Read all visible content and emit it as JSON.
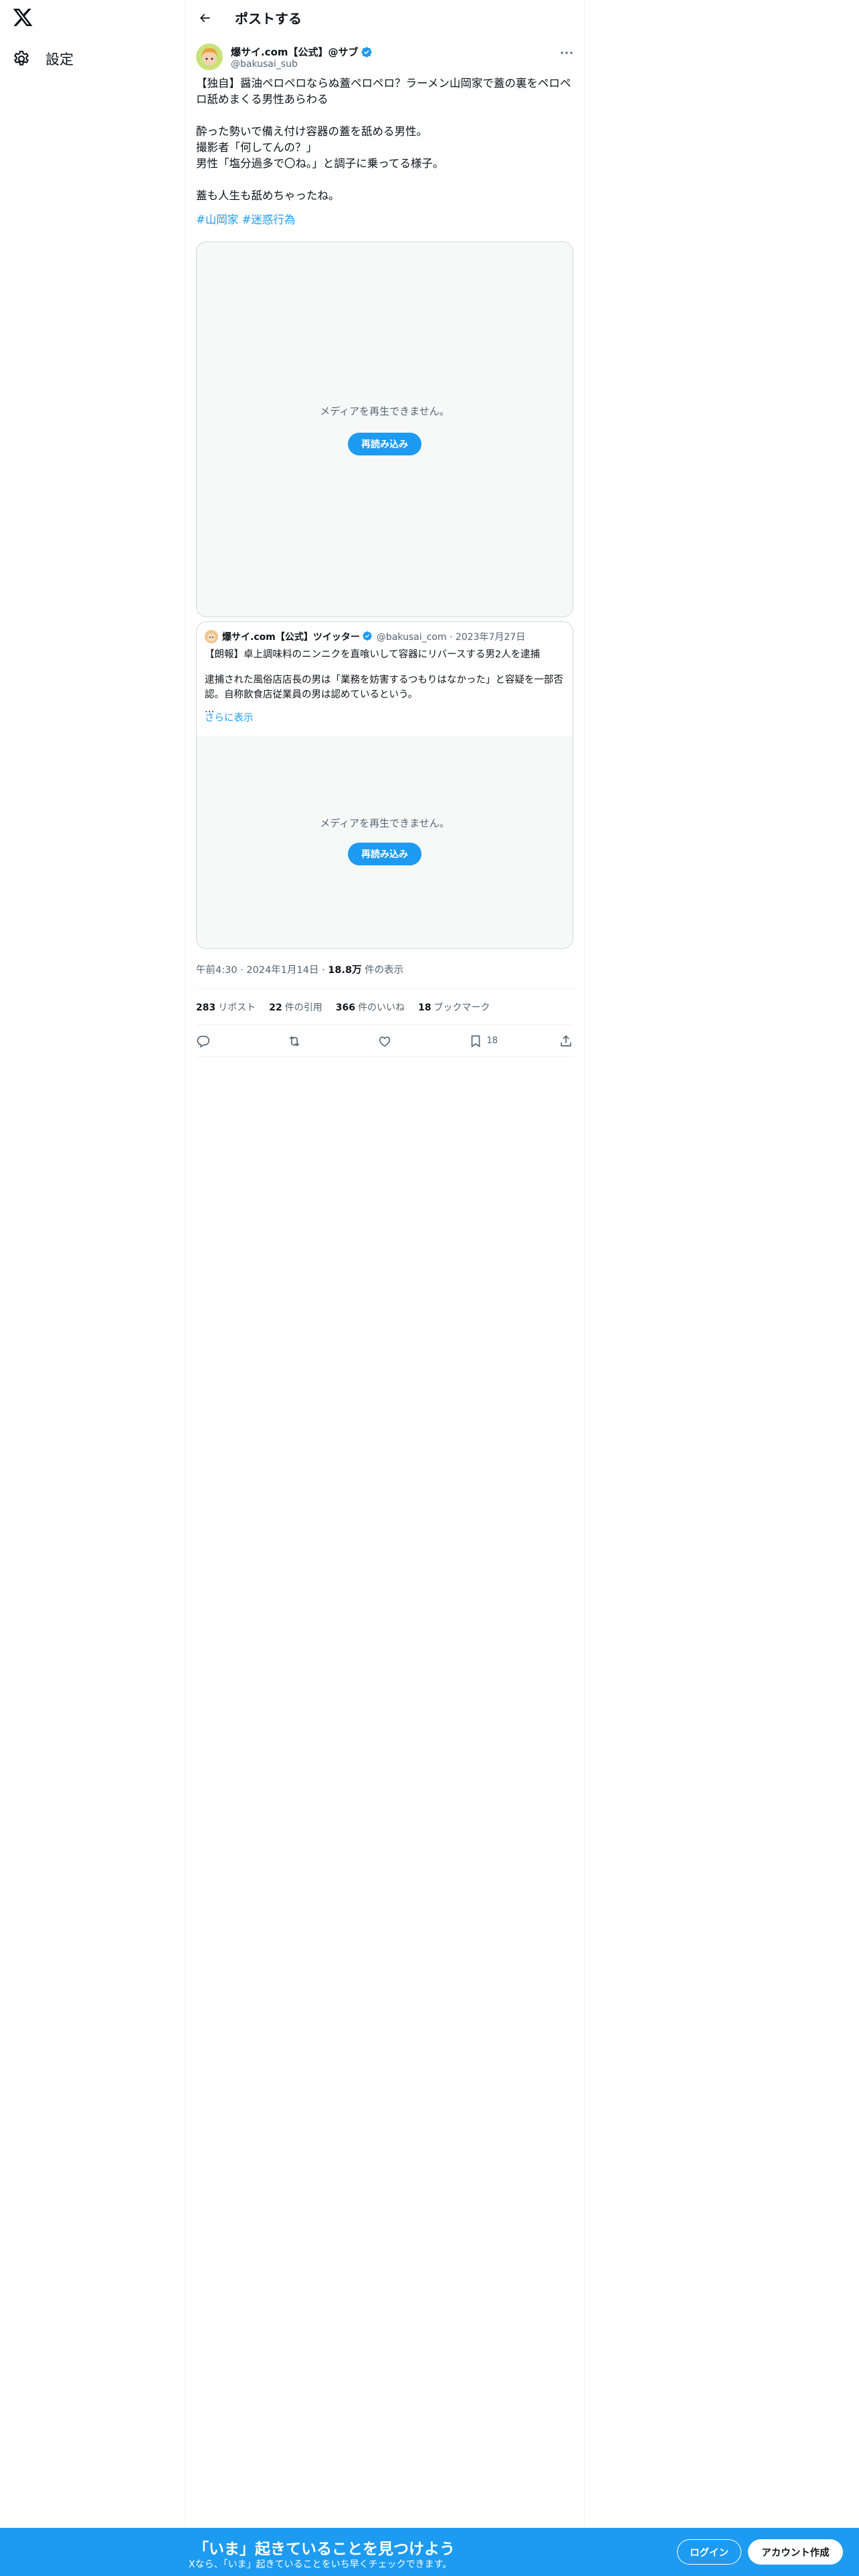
{
  "sidebar": {
    "logo": "x-logo-icon",
    "settings_label": "設定"
  },
  "header": {
    "title": "ポストする"
  },
  "post": {
    "author_name": "爆サイ.com【公式】@サブ",
    "author_handle": "@bakusai_sub",
    "lines": [
      "【独自】醤油ペロペロならぬ蓋ペロペロ？ラーメン山岡家で蓋の裏をペロペロ舐めまくる男性あらわる",
      "",
      "酔った勢いで備え付け容器の蓋を舐める男性。",
      "撮影者「何してんの？」",
      "男性「塩分過多で〇ね。」と調子に乗ってる様子。",
      "",
      "蓋も人生も舐めちゃったね。"
    ],
    "hashtags": [
      "#山岡家",
      "#迷惑行為"
    ],
    "media_message": "メディアを再生できません。",
    "reload_label": "再読み込み",
    "timestamp_prefix": "午前4:30 · 2024年1月14日 · ",
    "views": "18.8万",
    "views_suffix": " 件の表示"
  },
  "quote": {
    "author_name": "爆サイ.com【公式】ツイッター",
    "meta": "@bakusai_com · 2023年7月27日",
    "title": "【朗報】卓上調味料のニンニクを直喰いして容器にリバースする男2人を逮捕",
    "body": "逮捕された風俗店店長の男は「業務を妨害するつもりはなかった」と容疑を一部否認。自称飲食店従業員の男は認めているという。",
    "ellipsis": "…",
    "more_label": "さらに表示",
    "media_message": "メディアを再生できません。",
    "reload_label": "再読み込み"
  },
  "stats": {
    "reposts": "283",
    "reposts_label": "リポスト",
    "quotes": "22",
    "quotes_label": "件の引用",
    "likes": "366",
    "likes_label": "件のいいね",
    "bookmarks": "18",
    "bookmarks_label": "ブックマーク"
  },
  "actions": {
    "bookmark_count": "18"
  },
  "banner": {
    "headline": "「いま」起きていることを見つけよう",
    "sub": "Xなら、「いま」起きていることをいち早くチェックできます。",
    "login_label": "ログイン",
    "signup_label": "アカウント作成"
  },
  "colors": {
    "accent": "#1d9bf0",
    "text": "#0f1419",
    "muted": "#536471",
    "border": "#cfd9de"
  }
}
